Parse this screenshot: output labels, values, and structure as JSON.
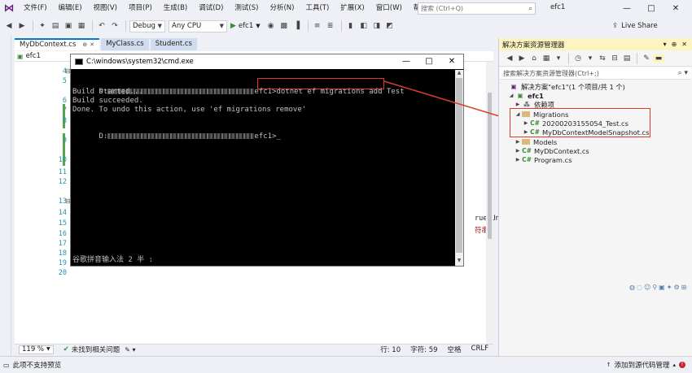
{
  "menubar": {
    "items": [
      "文件(F)",
      "编辑(E)",
      "视图(V)",
      "项目(P)",
      "生成(B)",
      "调试(D)",
      "测试(S)",
      "分析(N)",
      "工具(T)",
      "扩展(X)",
      "窗口(W)",
      "帮助(H)"
    ],
    "search_placeholder": "搜索 (Ctrl+Q)",
    "window_title": "efc1"
  },
  "toolbar": {
    "config": "Debug",
    "platform": "Any CPU",
    "run_label": "efc1",
    "liveshare": "Live Share"
  },
  "tabs": [
    {
      "label": "MyDbContext.cs",
      "active": true
    },
    {
      "label": "MyClass.cs",
      "active": false
    },
    {
      "label": "Student.cs",
      "active": false
    }
  ],
  "nav": {
    "project": "efc1"
  },
  "editor": {
    "line_numbers": [
      "4",
      "5",
      "6",
      "7",
      "8",
      "9",
      "10",
      "11",
      "12",
      "13",
      "14",
      "15",
      "16",
      "17",
      "18",
      "19",
      "20"
    ],
    "frag1": "rue;Un",
    "frag2": "符串"
  },
  "cmd": {
    "title": "C:\\windows\\system32\\cmd.exe",
    "line1_prefix": "D:",
    "line1_mid": "efc1>",
    "line1_command": "dotnet ef migrations add Test",
    "line2": "Build started...",
    "line3": "Build succeeded.",
    "line4": "Done. To undo this action, use 'ef migrations remove'",
    "line5_prefix": "D:",
    "line5_mid": "efc1>",
    "ime": "谷歌拼音输入法 2 半 :"
  },
  "status": {
    "zoom": "119 %",
    "issues": "未找到相关问题",
    "line": "行: 10",
    "char": "字符: 59",
    "space": "空格",
    "crlf": "CRLF"
  },
  "statusbar": {
    "left": "此项不支持预览",
    "right": "添加到源代码管理"
  },
  "solution": {
    "title": "解决方案资源管理器",
    "search_placeholder": "搜索解决方案资源管理器(Ctrl+;)",
    "root": "解决方案\"efc1\"(1 个项目/共 1 个)",
    "project": "efc1",
    "dependencies": "依赖项",
    "migrations": "Migrations",
    "mig_file1": "20200203155054_Test.cs",
    "mig_file2": "MyDbContextModelSnapshot.cs",
    "models": "Models",
    "dbcontext": "MyDbContext.cs",
    "program": "Program.cs"
  }
}
